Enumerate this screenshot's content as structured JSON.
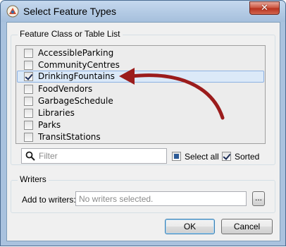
{
  "window": {
    "title": "Select Feature Types",
    "close_label": "✕"
  },
  "feature_group": {
    "label": "Feature Class or Table List",
    "items": [
      {
        "label": "AccessibleParking",
        "checked": false
      },
      {
        "label": "CommunityCentres",
        "checked": false
      },
      {
        "label": "DrinkingFountains",
        "checked": true
      },
      {
        "label": "FoodVendors",
        "checked": false
      },
      {
        "label": "GarbageSchedule",
        "checked": false
      },
      {
        "label": "Libraries",
        "checked": false
      },
      {
        "label": "Parks",
        "checked": false
      },
      {
        "label": "TransitStations",
        "checked": false
      }
    ],
    "filter_placeholder": "Filter",
    "select_all_label": "Select all",
    "sorted_label": "Sorted"
  },
  "writers_group": {
    "label": "Writers",
    "add_to_writers_label": "Add to writers:",
    "writers_placeholder": "No writers selected.",
    "browse_label": "..."
  },
  "buttons": {
    "ok": "OK",
    "cancel": "Cancel"
  },
  "colors": {
    "annotation_arrow": "#9b1c1c",
    "selection_background": "#dbe9f8",
    "title_bar": "#b7cde6"
  }
}
